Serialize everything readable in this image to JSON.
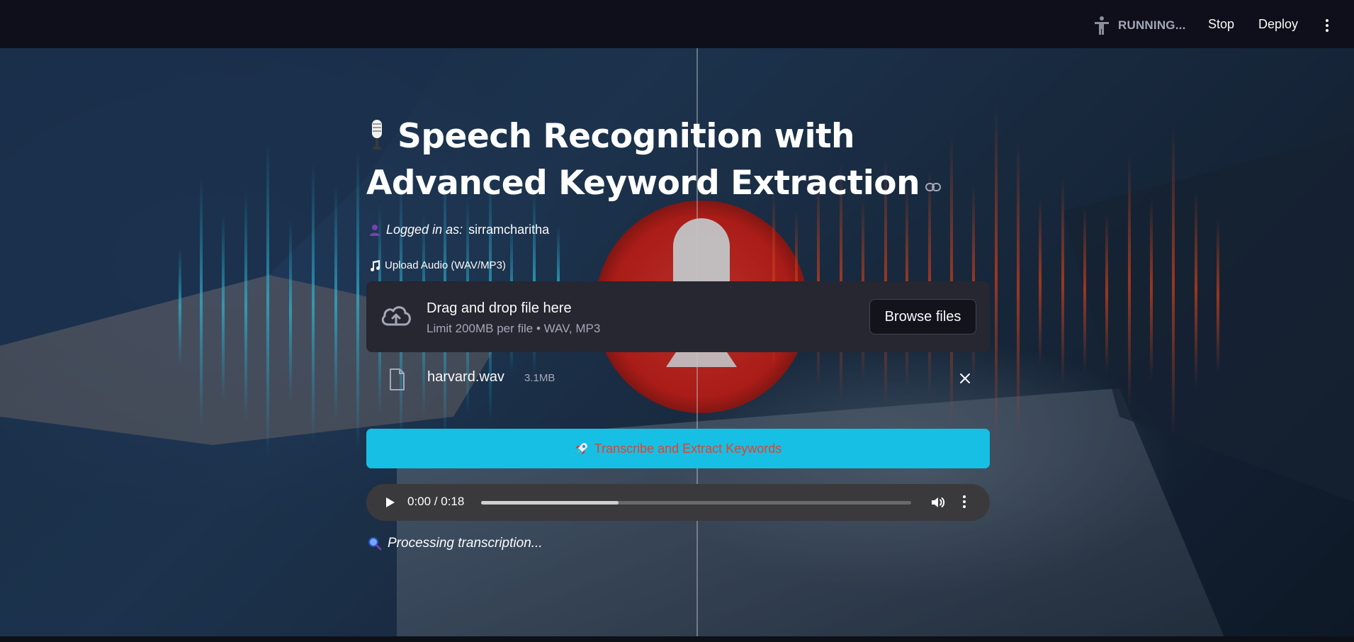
{
  "header": {
    "status_text": "RUNNING...",
    "stop_label": "Stop",
    "deploy_label": "Deploy",
    "icons": [
      "running-person-icon",
      "kebab-menu-icon"
    ]
  },
  "main": {
    "title_line1": "Speech Recognition with",
    "title_line2": "Advanced Keyword Extraction",
    "title_icons": [
      "microphone-icon",
      "link-icon"
    ],
    "login_label": "Logged in as:",
    "username": "sirramcharitha",
    "upload_label": "Upload Audio (WAV/MP3)",
    "dropzone": {
      "title": "Drag and drop file here",
      "subtitle": "Limit 200MB per file • WAV, MP3",
      "browse_label": "Browse files"
    },
    "file": {
      "name": "harvard.wav",
      "size": "3.1MB"
    },
    "primary_button_label": "Transcribe and Extract Keywords",
    "audio": {
      "time_display": "0:00 / 0:18",
      "buffered_fraction": 0.32
    },
    "status_message": "Processing transcription..."
  },
  "colors": {
    "header_bg": "#0e0f1a",
    "dropzone_bg": "#262730",
    "primary_button_bg": "#16bfe3",
    "primary_button_text": "#e8402e",
    "audio_bg": "#3a3a3c"
  }
}
